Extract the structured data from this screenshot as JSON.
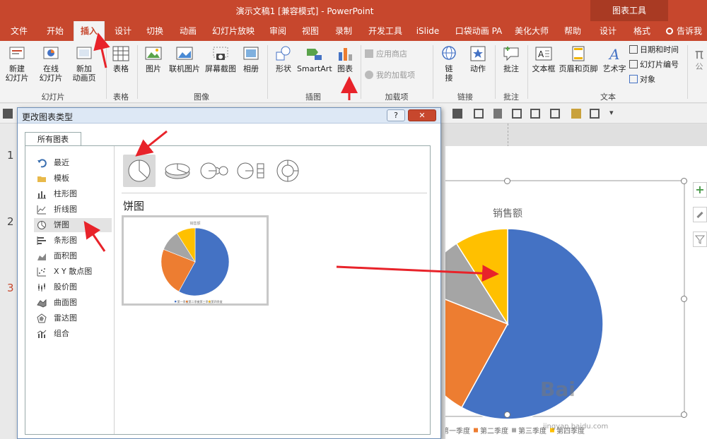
{
  "window": {
    "title": "演示文稿1 [兼容模式] - PowerPoint",
    "tool_tab": "图表工具"
  },
  "tabs": [
    "文件",
    "开始",
    "插入",
    "设计",
    "切换",
    "动画",
    "幻灯片放映",
    "审阅",
    "视图",
    "录制",
    "开发工具",
    "iSlide",
    "口袋动画 PA",
    "美化大师",
    "帮助",
    "设计",
    "格式"
  ],
  "active_tab": "插入",
  "tell_me": "告诉我",
  "ribbon": {
    "groups": [
      "幻灯片",
      "表格",
      "图像",
      "插图",
      "加载项",
      "链接",
      "批注",
      "文本"
    ],
    "buttons": {
      "new_slide": "新建\n幻灯片",
      "online_slide": "在线\n幻灯片",
      "new_anim_page": "新加\n动画页",
      "table": "表格",
      "picture": "图片",
      "online_picture": "联机图片",
      "screenshot": "屏幕截图",
      "album": "相册",
      "shapes": "形状",
      "smartart": "SmartArt",
      "chart": "图表",
      "store": "应用商店",
      "my_addins": "我的加载项",
      "link": "链\n接",
      "action": "动作",
      "comment": "批注",
      "textbox": "文本框",
      "header_footer": "页眉和页脚",
      "wordart": "艺术字",
      "date_time": "日期和时间",
      "slide_number": "幻灯片编号",
      "object": "对象",
      "formula_partial": "公"
    }
  },
  "dialog": {
    "title": "更改图表类型",
    "help": "?",
    "tab": "所有图表",
    "categories": [
      "最近",
      "模板",
      "柱形图",
      "折线图",
      "饼图",
      "条形图",
      "面积图",
      "X Y 散点图",
      "股价图",
      "曲面图",
      "雷达图",
      "组合"
    ],
    "selected_category": "饼图",
    "heading": "饼图",
    "subtypes": [
      "饼图",
      "三维饼图",
      "子母饼图",
      "复合条饼图",
      "圆环图"
    ]
  },
  "slide_numbers": [
    "1",
    "2",
    "3"
  ],
  "watermark": "Bai",
  "watermark_url": "jingyan.baidu.com",
  "chart_data": {
    "type": "pie",
    "title": "销售额",
    "categories": [
      "第一季度",
      "第二季度",
      "第三季度",
      "第四季度"
    ],
    "values": [
      58,
      23,
      10,
      9
    ],
    "colors": [
      "#4472c4",
      "#ed7d31",
      "#a5a5a5",
      "#ffc000"
    ],
    "legend_position": "bottom"
  }
}
